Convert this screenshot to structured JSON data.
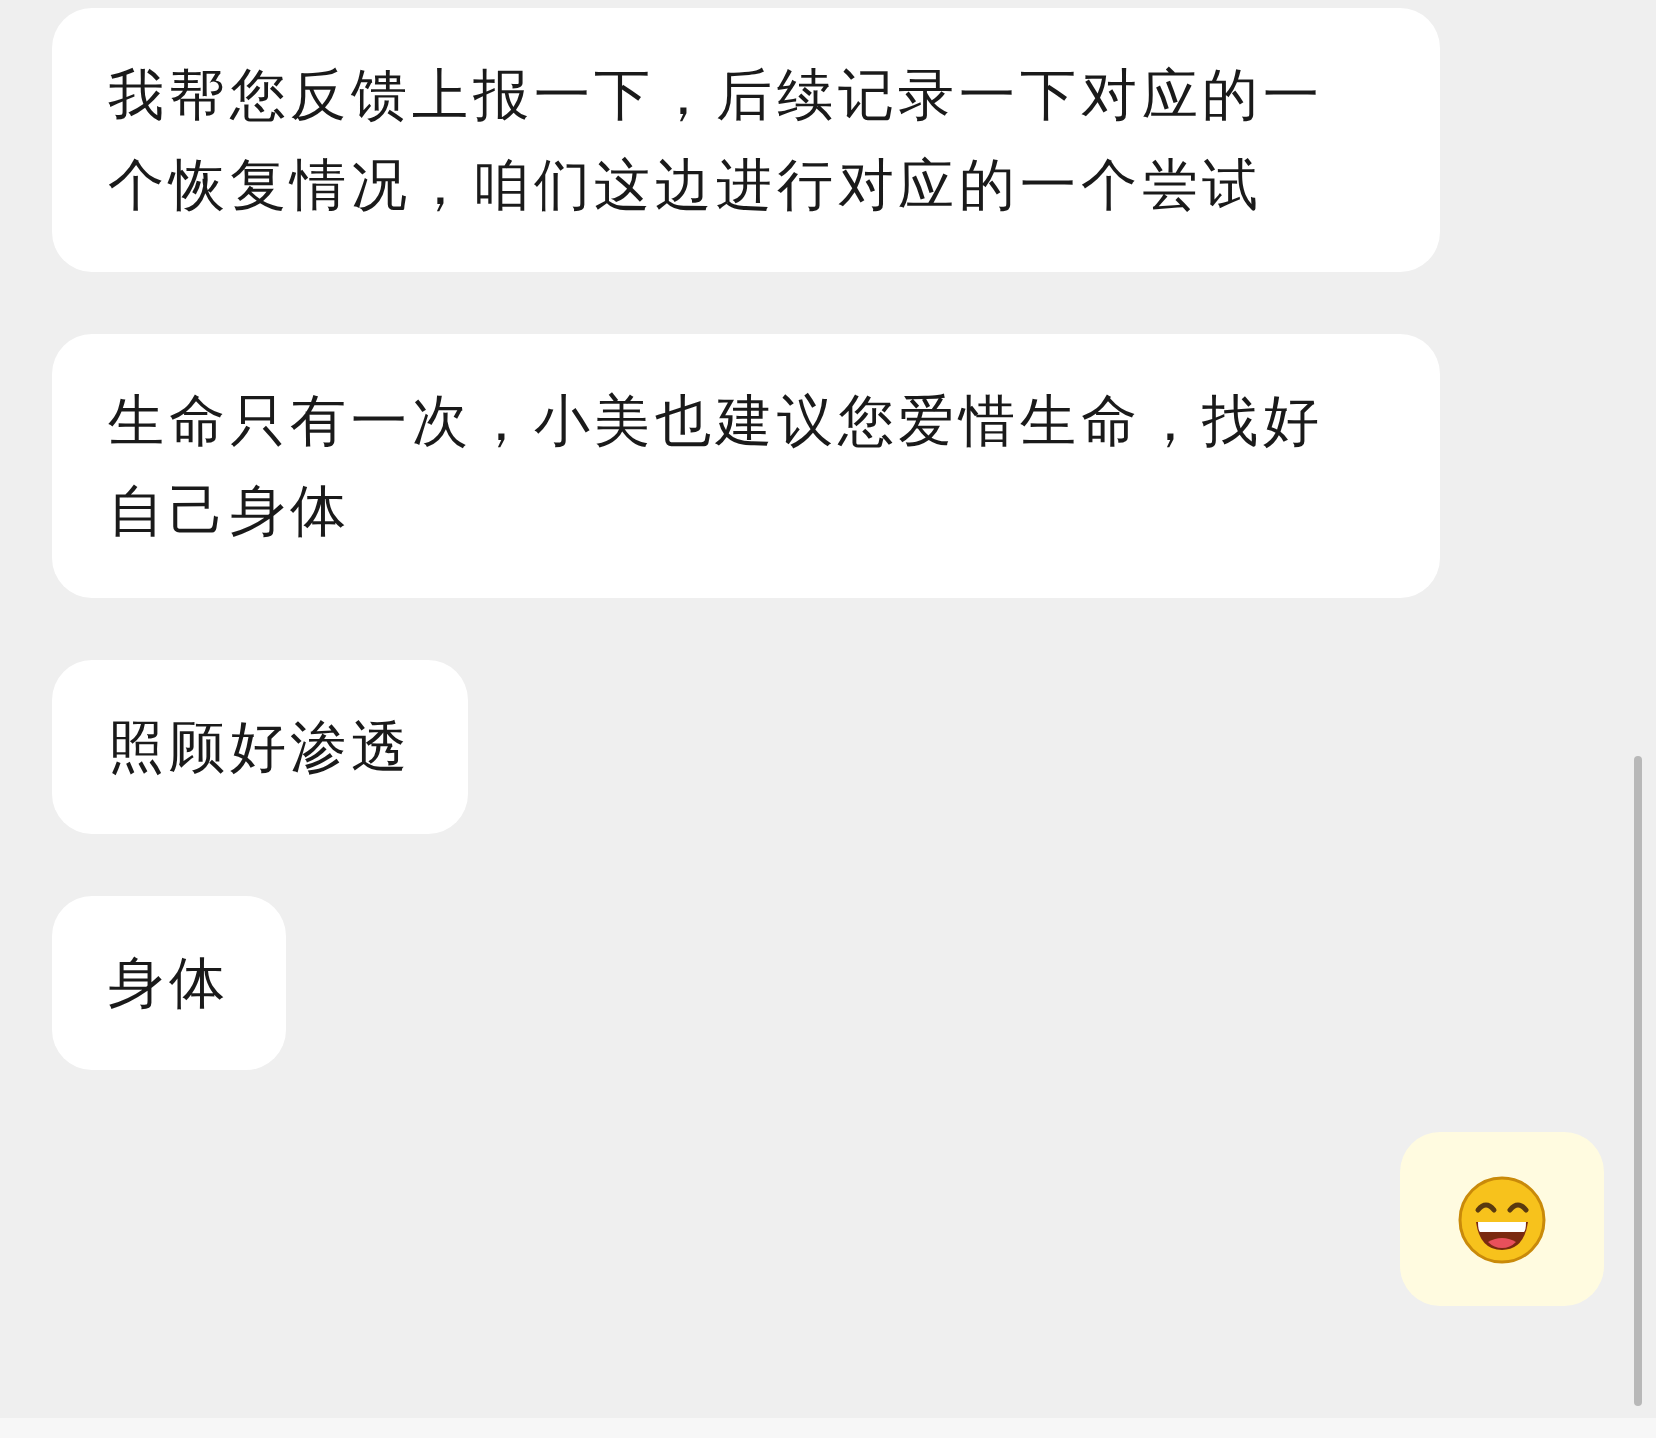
{
  "messages": [
    {
      "outgoing": false,
      "kind": "text",
      "text": "我帮您反馈上报一下，后续记录一下对应的一个恢复情况，咱们这边进行对应的一个尝试"
    },
    {
      "outgoing": false,
      "kind": "text",
      "text": "生命只有一次，小美也建议您爱惜生命，找好自己身体"
    },
    {
      "outgoing": false,
      "kind": "text",
      "text": "照顾好渗透"
    },
    {
      "outgoing": false,
      "kind": "text",
      "text": "身体"
    },
    {
      "outgoing": true,
      "kind": "emoji"
    }
  ]
}
